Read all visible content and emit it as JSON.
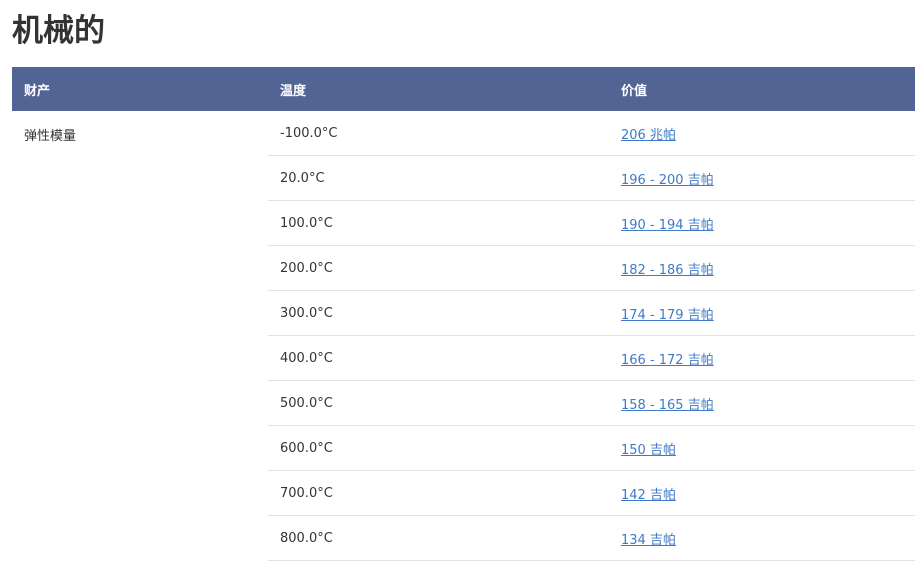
{
  "page": {
    "title": "机械的"
  },
  "table": {
    "headers": {
      "property": "财产",
      "temperature": "温度",
      "value": "价值"
    },
    "property_name": "弹性模量",
    "rows": [
      {
        "temperature": "-100.0°C",
        "value": "206 兆帕"
      },
      {
        "temperature": "20.0°C",
        "value": "196 - 200 吉帕"
      },
      {
        "temperature": "100.0°C",
        "value": "190 - 194 吉帕"
      },
      {
        "temperature": "200.0°C",
        "value": "182 - 186 吉帕"
      },
      {
        "temperature": "300.0°C",
        "value": "174 - 179 吉帕"
      },
      {
        "temperature": "400.0°C",
        "value": "166 - 172 吉帕"
      },
      {
        "temperature": "500.0°C",
        "value": "158 - 165 吉帕"
      },
      {
        "temperature": "600.0°C",
        "value": "150 吉帕"
      },
      {
        "temperature": "700.0°C",
        "value": "142 吉帕"
      },
      {
        "temperature": "800.0°C",
        "value": "134 吉帕"
      }
    ]
  },
  "colors": {
    "header_background": "#516494",
    "link": "#3f7ac9",
    "divider": "#e2e2e2"
  }
}
